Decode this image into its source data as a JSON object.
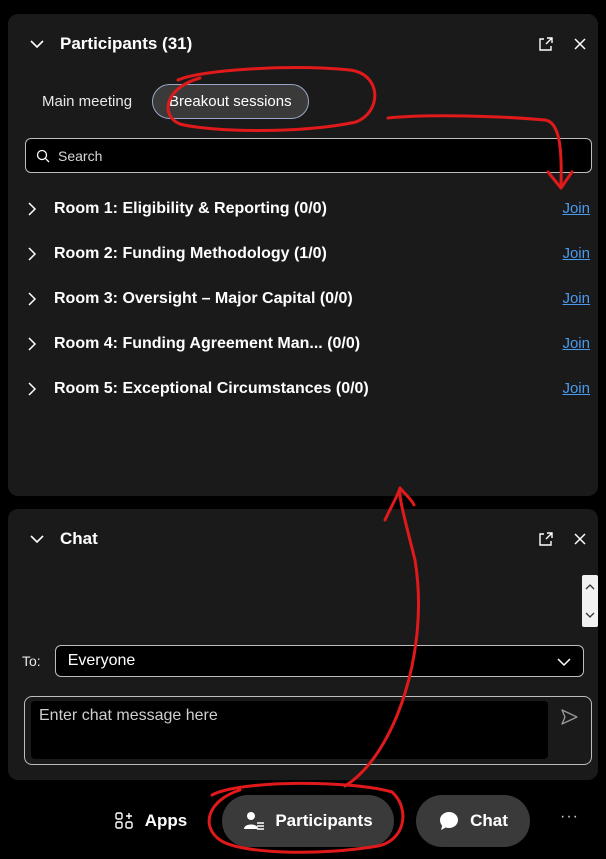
{
  "participants_panel": {
    "title": "Participants (31)",
    "tabs": [
      {
        "label": "Main meeting",
        "active": false
      },
      {
        "label": "Breakout sessions",
        "active": true
      }
    ],
    "search": {
      "placeholder": "Search"
    },
    "rooms": [
      {
        "name": "Room 1: Eligibility & Reporting (0/0)",
        "action": "Join"
      },
      {
        "name": "Room 2: Funding Methodology (1/0)",
        "action": "Join"
      },
      {
        "name": "Room 3: Oversight – Major Capital (0/0)",
        "action": "Join"
      },
      {
        "name": "Room 4: Funding Agreement Man... (0/0)",
        "action": "Join"
      },
      {
        "name": "Room 5: Exceptional Circumstances (0/0)",
        "action": "Join"
      }
    ]
  },
  "chat_panel": {
    "title": "Chat",
    "to_label": "To:",
    "to_value": "Everyone",
    "message_placeholder": "Enter chat message here"
  },
  "bottombar": {
    "apps_label": "Apps",
    "participants_label": "Participants",
    "chat_label": "Chat",
    "more_label": "···"
  },
  "colors": {
    "link": "#4a9bf0",
    "annotation": "#e0191b",
    "panel_bg": "#1a1a1a",
    "button_bg": "#3a3a3a"
  }
}
